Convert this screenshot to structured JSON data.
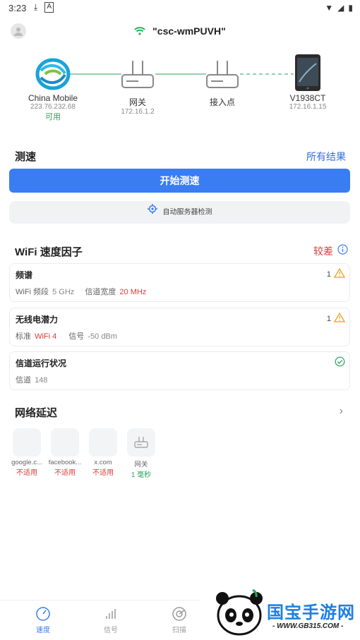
{
  "status_bar": {
    "time": "3:23"
  },
  "header": {
    "ssid": "\"csc-wmPUVH\""
  },
  "topology": {
    "isp": {
      "name": "China Mobile",
      "ip": "223.76.232.68",
      "status": "可用"
    },
    "gateway": {
      "name": "网关",
      "ip": "172.16.1.2"
    },
    "access_point": {
      "name": "接入点"
    },
    "device": {
      "name": "V1938CT",
      "ip": "172.16.1.15"
    }
  },
  "speedtest": {
    "title": "测速",
    "all_results": "所有结果",
    "start_button": "开始测速",
    "auto_server": "自动服务器检测"
  },
  "wifi_factors": {
    "title": "WiFi 速度因子",
    "rating": "较差",
    "cards": [
      {
        "title": "频谱",
        "count": "1",
        "label1": "WiFi 频段",
        "value1": "5 GHz",
        "label2": "信道宽度",
        "value2": "20 MHz"
      },
      {
        "title": "无线电潜力",
        "count": "1",
        "label1": "标准",
        "value1": "WiFi 4",
        "label2": "信号",
        "value2": "-50 dBm"
      },
      {
        "title": "信道运行状况",
        "label1": "信道",
        "value1": "148"
      }
    ]
  },
  "latency": {
    "title": "网络延迟",
    "items": [
      {
        "label": "google.c...",
        "status": "不适用"
      },
      {
        "label": "facebook...",
        "status": "不适用"
      },
      {
        "label": "x.com",
        "status": "不适用"
      },
      {
        "label": "网关",
        "status": "1 毫秒"
      }
    ]
  },
  "bottom_nav": {
    "items": [
      "速度",
      "信号",
      "扫描"
    ]
  },
  "watermark": {
    "brand": "国宝手游网",
    "url": "- WWW.GB315.COM -"
  },
  "colors": {
    "accent": "#3a7df2",
    "green": "#2aa35a",
    "red": "#e03a3a",
    "warning": "#f0a020"
  }
}
